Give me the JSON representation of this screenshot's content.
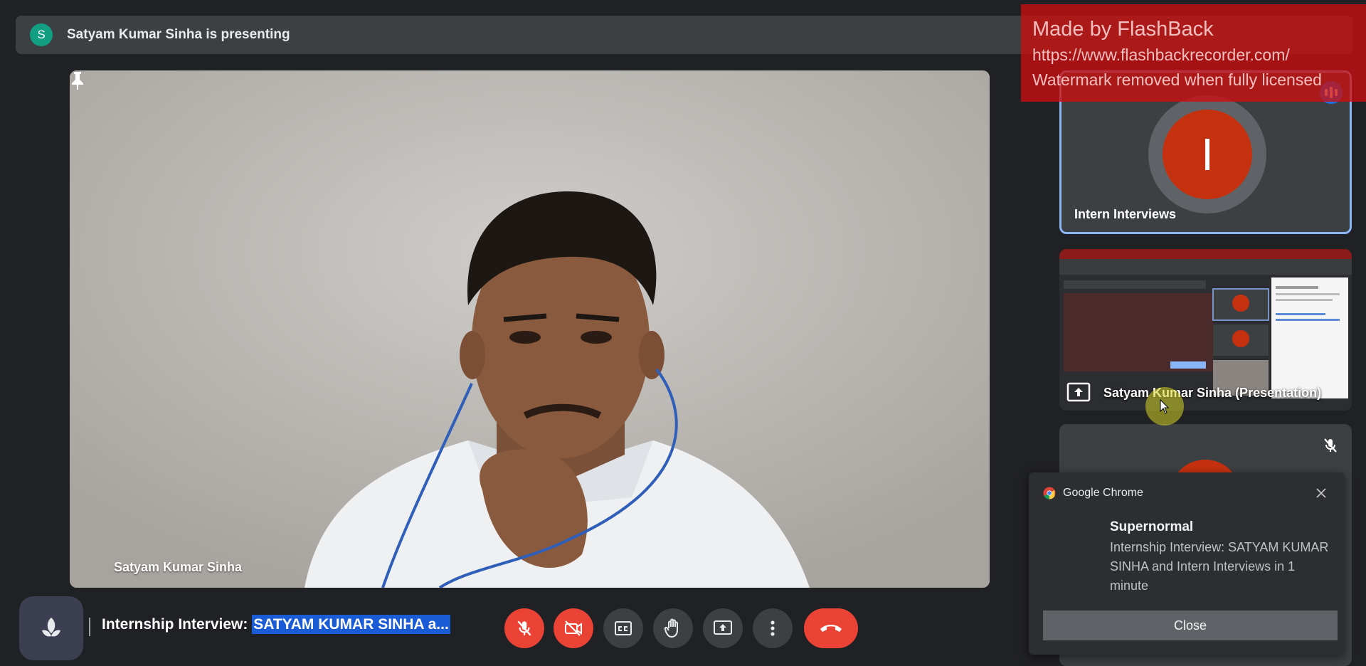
{
  "banner": {
    "avatar_letter": "S",
    "text": "Satyam Kumar Sinha is presenting"
  },
  "main_tile": {
    "name": "Satyam Kumar Sinha"
  },
  "side_tiles": [
    {
      "avatar_letter": "I",
      "label": "Intern Interviews",
      "speaking": true
    },
    {
      "label": "Satyam Kumar Sinha (Presentation)"
    },
    {
      "muted": true
    }
  ],
  "watermark": {
    "line1": "Made by FlashBack",
    "line2": "https://www.flashbackrecorder.com/",
    "line3": "Watermark removed when fully licensed"
  },
  "notification": {
    "app": "Google Chrome",
    "title": "Supernormal",
    "body": "Internship Interview: SATYAM KUMAR SINHA and Intern Interviews in 1 minute",
    "button": "Close"
  },
  "bottom_bar": {
    "meeting_title_prefix": "Internship Interview: ",
    "meeting_title_selected": "SATYAM KUMAR SINHA a...",
    "controls": [
      "mic-off-icon",
      "camera-off-icon",
      "captions-icon",
      "raise-hand-icon",
      "present-icon",
      "more-options-icon",
      "end-call-icon"
    ]
  },
  "colors": {
    "background": "#202124",
    "danger": "#ea4335",
    "accent": "#8ab4f8",
    "selection": "#1a5bd6"
  }
}
